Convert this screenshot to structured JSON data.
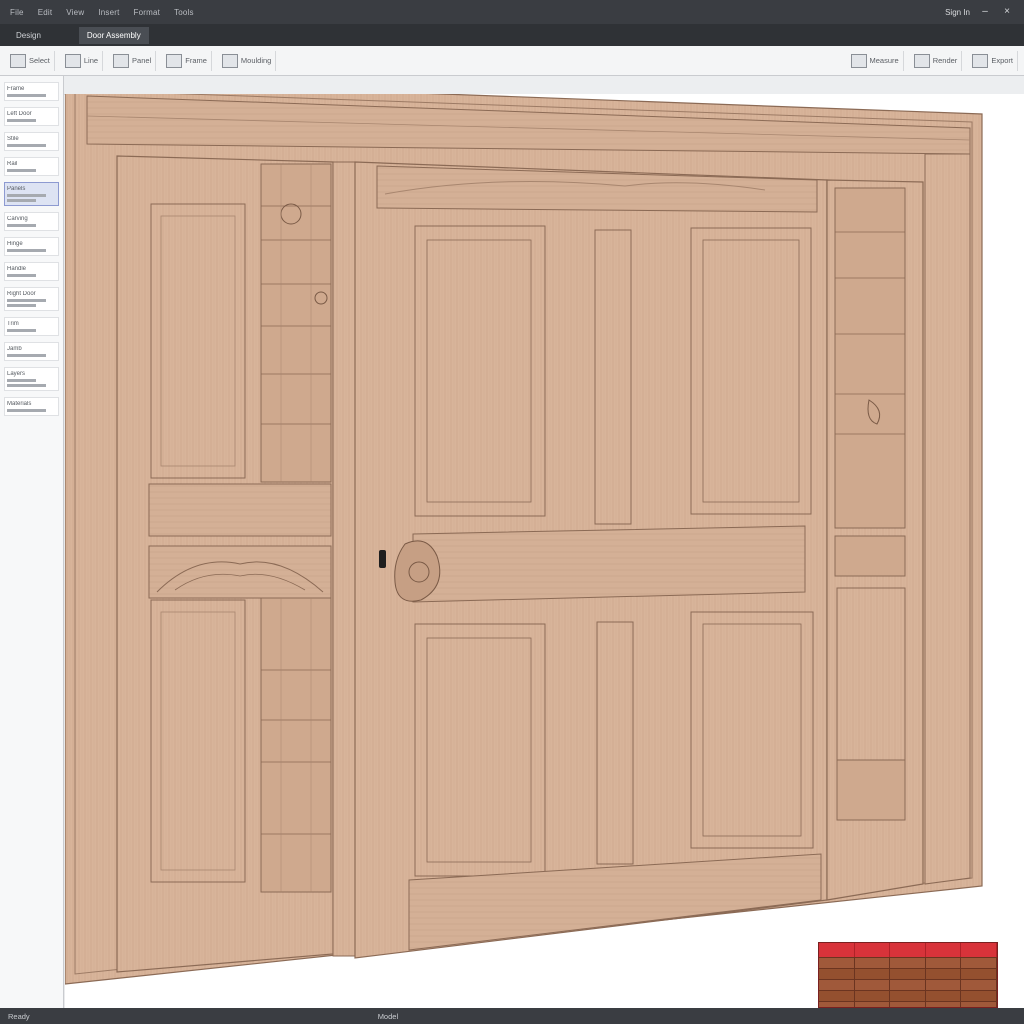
{
  "titlebar": {
    "menu": [
      "File",
      "Edit",
      "View",
      "Insert",
      "Format",
      "Tools"
    ],
    "right_label": "Sign In"
  },
  "tabs": [
    {
      "label": "Design"
    },
    {
      "label": "Door Assembly"
    }
  ],
  "ribbon": {
    "tools": [
      "Select",
      "Line",
      "Panel",
      "Frame",
      "Moulding",
      "Measure",
      "Render",
      "Export"
    ]
  },
  "leftpanel": {
    "items": [
      "Frame",
      "Left Door",
      "Stile",
      "Rail",
      "Panels",
      "Carving",
      "Hinge",
      "Handle",
      "Right Door",
      "Trim",
      "Jamb",
      "Layers",
      "Materials"
    ]
  },
  "statusbar": {
    "left": "Ready",
    "mid": "Model",
    "right": ""
  },
  "colors": {
    "wood": "#d8b49a",
    "wood_dark": "#b8917a",
    "wood_line": "#8b6a55",
    "table_header": "#d8333a"
  }
}
